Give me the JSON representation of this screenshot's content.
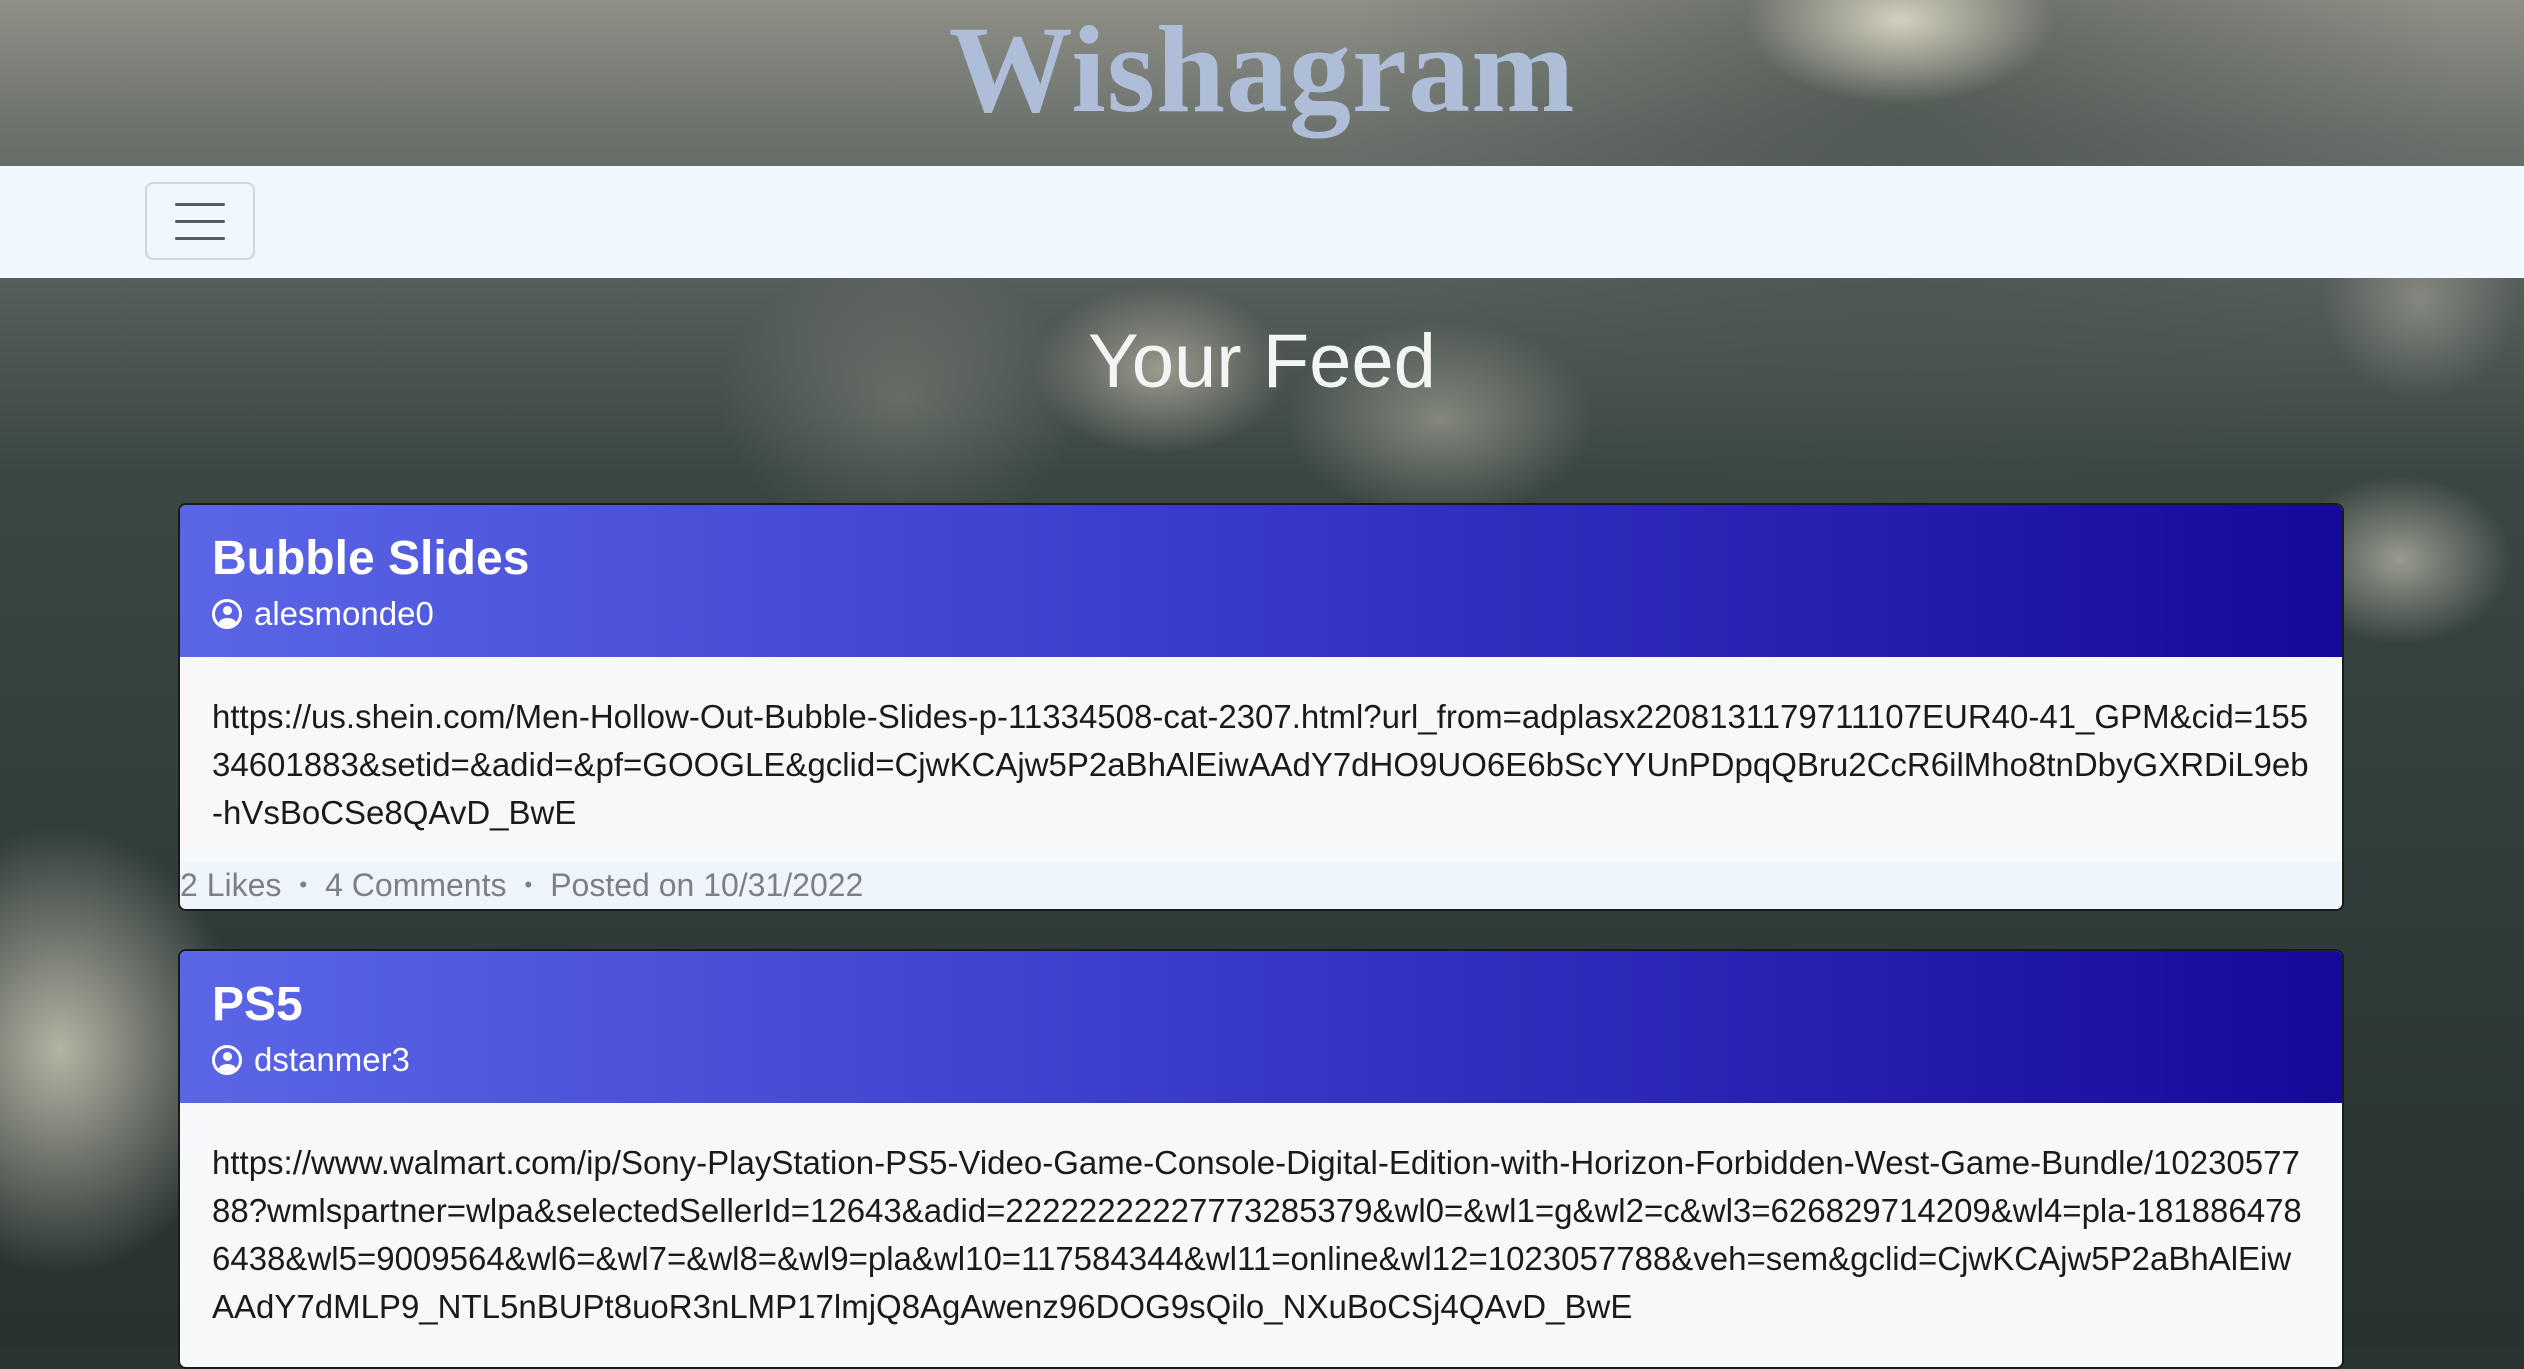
{
  "header": {
    "brand": "Wishagram"
  },
  "navbar": {
    "toggler_icon": "hamburger-icon"
  },
  "page": {
    "title": "Your Feed"
  },
  "posts": [
    {
      "title": "Bubble Slides",
      "user": "alesmonde0",
      "url": "https://us.shein.com/Men-Hollow-Out-Bubble-Slides-p-11334508-cat-2307.html?url_from=adplasx2208131179711107EUR40-41_GPM&cid=15534601883&setid=&adid=&pf=GOOGLE&gclid=CjwKCAjw5P2aBhAlEiwAAdY7dHO9UO6E6bScYYUnPDpqQBru2CcR6ilMho8tnDbyGXRDiL9eb-hVsBoCSe8QAvD_BwE",
      "likes": "2 Likes",
      "comments": "4 Comments",
      "posted": "Posted on 10/31/2022"
    },
    {
      "title": "PS5",
      "user": "dstanmer3",
      "url": "https://www.walmart.com/ip/Sony-PlayStation-PS5-Video-Game-Console-Digital-Edition-with-Horizon-Forbidden-West-Game-Bundle/1023057788?wmlspartner=wlpa&selectedSellerId=12643&adid=22222222227773285379&wl0=&wl1=g&wl2=c&wl3=626829714209&wl4=pla-1818864786438&wl5=9009564&wl6=&wl7=&wl8=&wl9=pla&wl10=117584344&wl11=online&wl12=1023057788&veh=sem&gclid=CjwKCAjw5P2aBhAlEiwAAdY7dMLP9_NTL5nBUPt8uoR3nLMP17lmjQ8AgAwenz96DOG9sQilo_NXuBoCSj4QAvD_BwE"
    }
  ],
  "colors": {
    "brand": "#aebed8",
    "navbar_bg": "#f0f7ff",
    "card_header_start": "#5b66e6",
    "card_header_end": "#15099a"
  }
}
